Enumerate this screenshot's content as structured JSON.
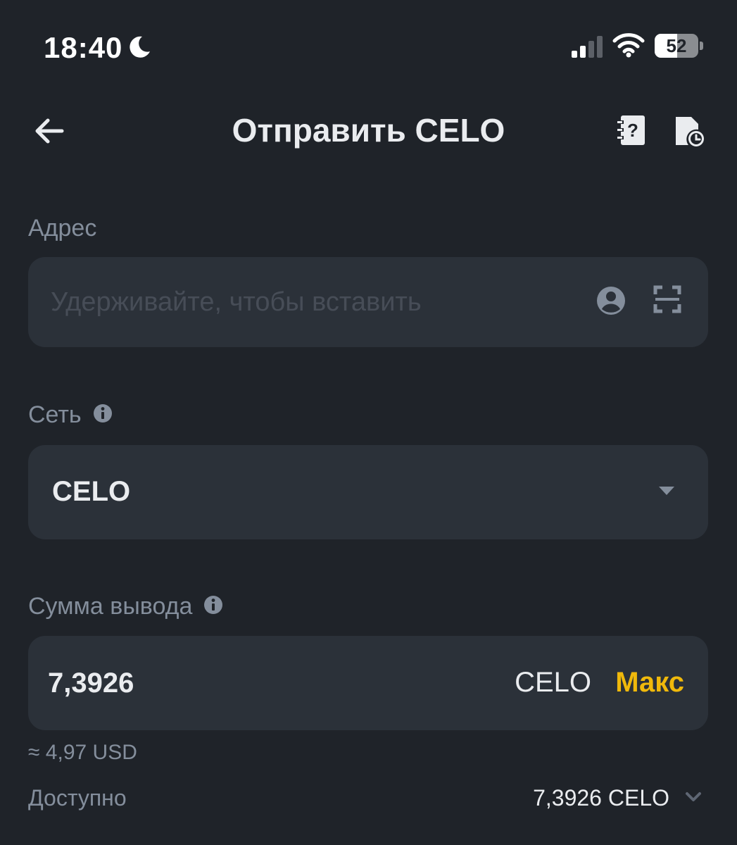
{
  "status_bar": {
    "time": "18:40",
    "battery": "52",
    "battery_level": 0.52
  },
  "header": {
    "title": "Отправить CELO"
  },
  "address": {
    "label": "Адрес",
    "placeholder": "Удерживайте, чтобы вставить"
  },
  "network": {
    "label": "Сеть",
    "selected": "CELO"
  },
  "amount": {
    "label": "Сумма вывода",
    "value": "7,3926",
    "unit": "CELO",
    "max_label": "Макс",
    "usd_estimate": "≈ 4,97 USD"
  },
  "available": {
    "label": "Доступно",
    "value": "7,3926 CELO"
  },
  "colors": {
    "background": "#1f2329",
    "field": "#2b3139",
    "accent": "#f0b90b",
    "muted": "#848e9c"
  },
  "icons": [
    "moon-icon",
    "signal-icon",
    "wifi-icon",
    "battery-icon",
    "back-arrow-icon",
    "faq-icon",
    "history-icon",
    "contact-icon",
    "scan-icon",
    "info-icon",
    "caret-down-icon",
    "chevron-down-icon"
  ]
}
